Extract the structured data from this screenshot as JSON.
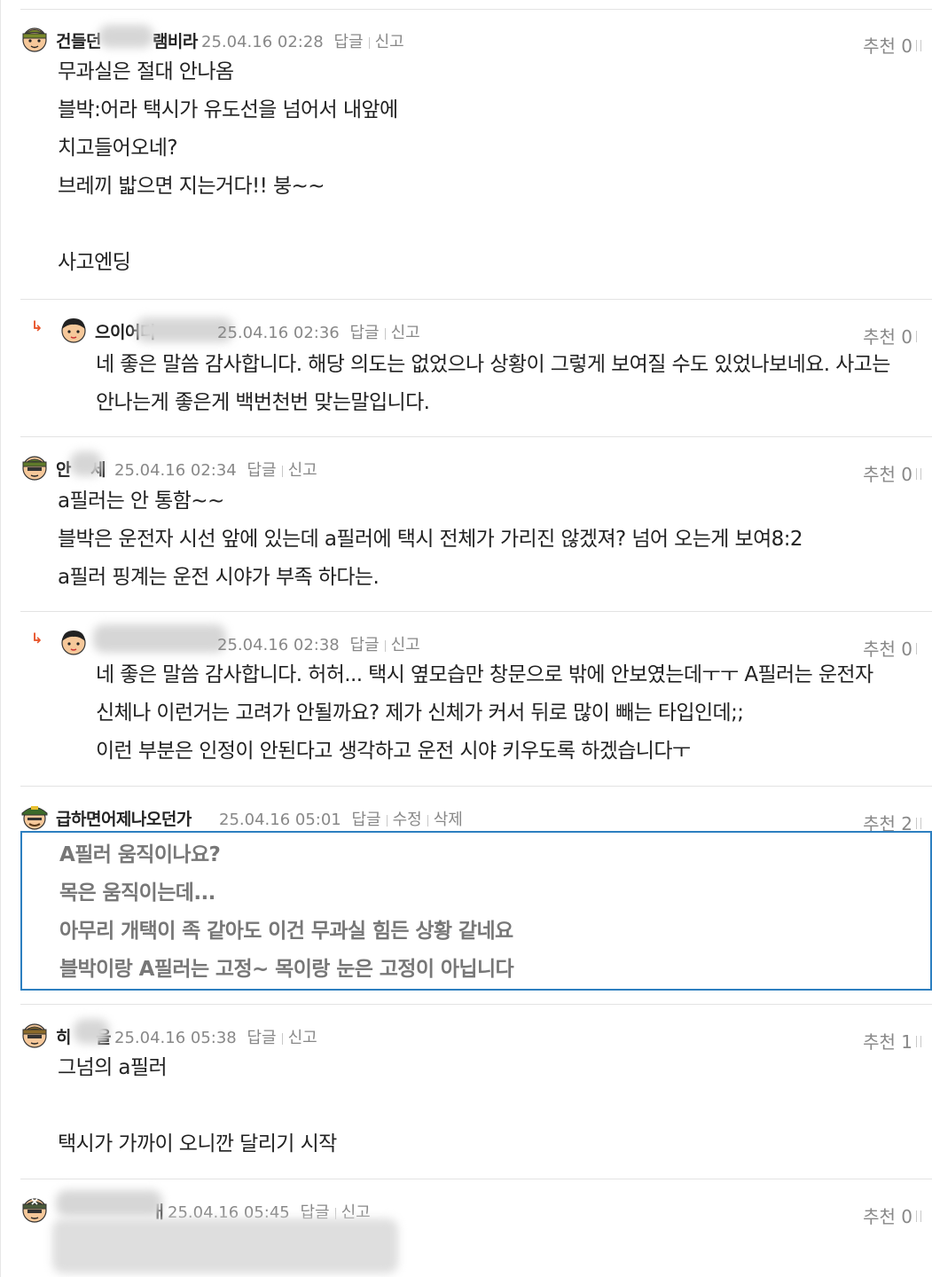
{
  "labels": {
    "reply": "답글",
    "report": "신고",
    "edit": "수정",
    "delete": "삭제",
    "vote": "추천"
  },
  "comments": [
    {
      "nick_left": "건들던",
      "nick_right": "램비라",
      "date": "25.04.16 02:28",
      "votes": "0",
      "lines": [
        "무과실은 절대 안나옴",
        "블박:어라 택시가 유도선을 넘어서 내앞에",
        "치고들어오네?",
        "브레끼 밟으면 지는거다!! 붕~~",
        "",
        "사고엔딩"
      ]
    },
    {
      "nick_left": "으이어더",
      "nick_right": "",
      "date": "25.04.16 02:36",
      "votes": "0",
      "lines": [
        "네 좋은 말씀 감사합니다. 해당 의도는 없었으나 상황이 그렇게 보여질 수도 있었나보네요. 사고는",
        "안나는게 좋은게 백번천번 맞는말입니다."
      ]
    },
    {
      "nick_left": "안",
      "nick_right": "세",
      "date": "25.04.16 02:34",
      "votes": "0",
      "lines": [
        "a필러는 안 통함~~",
        "블박은 운전자 시선 앞에 있는데 a필러에 택시 전체가 가리진 않겠져? 넘어 오는게 보여8:2",
        "a필러 핑계는 운전 시야가 부족 하다는."
      ]
    },
    {
      "nick_left": "",
      "nick_right": "",
      "date": "25.04.16 02:38",
      "votes": "0",
      "lines": [
        "네 좋은 말씀 감사합니다. 허허... 택시 옆모습만 창문으로 밖에 안보였는데ㅜㅜ A필러는 운전자",
        "신체나 이런거는 고려가 안될까요? 제가 신체가 커서 뒤로 많이 빼는 타입인데;;",
        "이런 부분은 인정이 안된다고 생각하고 운전 시야 키우도록 하겠습니다ㅜ"
      ]
    },
    {
      "nick": "급하면어제나오던가",
      "date": "25.04.16 05:01",
      "votes": "2",
      "edit_lines": [
        "A필러 움직이나요?",
        "목은 움직이는데...",
        "아무리 개택이 족 같아도 이건 무과실 힘든 상황 같네요",
        "블박이랑 A필러는 고정~ 목이랑 눈은 고정이 아닙니다"
      ]
    },
    {
      "nick_left": "히",
      "nick_right": "을",
      "date": "25.04.16 05:38",
      "votes": "1",
      "lines": [
        "그넘의 a필러",
        "",
        "택시가 가까이 오니깐 달리기 시작"
      ]
    },
    {
      "nick_left": "",
      "nick_right": "ㅐ",
      "date": "25.04.16 05:45",
      "votes": "0",
      "lines": []
    }
  ]
}
